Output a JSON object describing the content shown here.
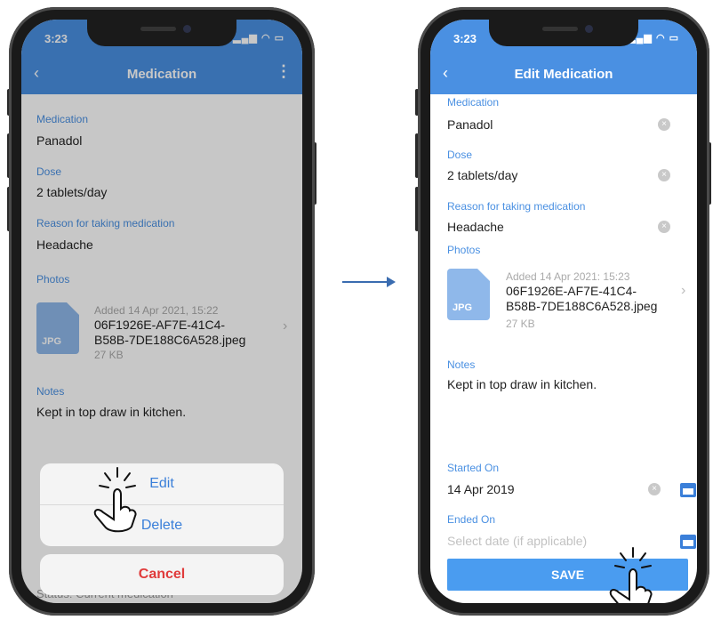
{
  "left_screen": {
    "status_time": "3:23",
    "status_icons": "иии ● ▭",
    "nav_title": "Medication",
    "nav_back": "‹",
    "nav_more": "⋮",
    "fields": [
      {
        "label": "Medication",
        "value": "Panadol"
      },
      {
        "label": "Dose",
        "value": "2 tablets/day"
      },
      {
        "label": "Reason for taking medication",
        "value": "Headache"
      }
    ],
    "photos_label": "Photos",
    "photo": {
      "added": "Added 14 Apr 2021, 15:22",
      "name_line1": "06F1926E-AF7E-41C4-",
      "name_line2": "B58B-7DE188C6A528.jpeg",
      "size": "27 KB",
      "ext": "JPG"
    },
    "notes_label": "Notes",
    "notes_value": "Kept in top draw in kitchen.",
    "status_partial": "Status:  Current medication",
    "action_sheet": {
      "edit": "Edit",
      "delete": "Delete",
      "cancel": "Cancel"
    }
  },
  "right_screen": {
    "status_time": "3:23",
    "status_icons": "иии ● ▭",
    "nav_title": "Edit Medication",
    "nav_back": "‹",
    "partial_label": "Medication",
    "fields": [
      {
        "value": "Panadol"
      },
      {
        "label": "Dose",
        "value": "2 tablets/day"
      },
      {
        "label": "Reason for taking medication",
        "value": "Headache"
      }
    ],
    "photos_label": "Photos",
    "photo": {
      "added": "Added 14 Apr 2021: 15:23",
      "name_line1": "06F1926E-AF7E-41C4-",
      "name_line2": "B58B-7DE188C6A528.jpeg",
      "size": "27 KB",
      "ext": "JPG"
    },
    "notes_label": "Notes",
    "notes_value": "Kept in top draw in kitchen.",
    "started_label": "Started On",
    "started_value": "14 Apr 2019",
    "ended_label": "Ended On",
    "ended_placeholder": "Select date (if applicable)",
    "save_label": "SAVE"
  },
  "colors": {
    "accent": "#4a90e2",
    "destructive": "#e03b3b",
    "save": "#4a9cf0"
  }
}
